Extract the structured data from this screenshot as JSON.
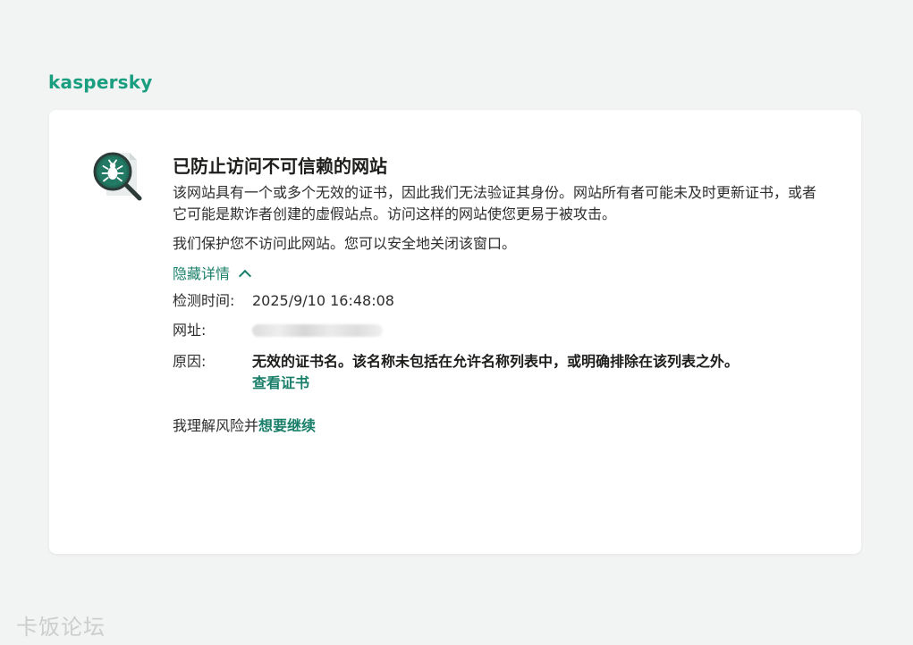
{
  "brand": {
    "logo_text": "kaspersky"
  },
  "alert": {
    "title": "已防止访问不可信赖的网站",
    "description": "该网站具有一个或多个无效的证书，因此我们无法验证其身份。网站所有者可能未及时更新证书，或者它可能是欺诈者创建的虚假站点。访问这样的网站使您更易于被攻击。",
    "protection_note": "我们保护您不访问此网站。您可以安全地关闭该窗口。",
    "toggle_label": "隐藏详情",
    "details": {
      "detect_time_label": "检测时间:",
      "detect_time_value": "2025/9/10 16:48:08",
      "url_label": "网址:",
      "reason_label": "原因:",
      "reason_value": "无效的证书名。该名称未包括在允许名称列表中，或明确排除在该列表之外。",
      "view_cert_label": "查看证书"
    },
    "continue_prefix": "我理解风险并",
    "continue_link": "想要继续"
  },
  "watermark": "卡饭论坛",
  "colors": {
    "accent": "#1a7f6a",
    "logo": "#1a9e80",
    "icon_circle": "#1f6b58",
    "background": "#f2f3f3",
    "card": "#ffffff"
  },
  "icons": {
    "alert_icon": "magnifier-bug-icon",
    "toggle_icon": "chevron-up-icon"
  }
}
